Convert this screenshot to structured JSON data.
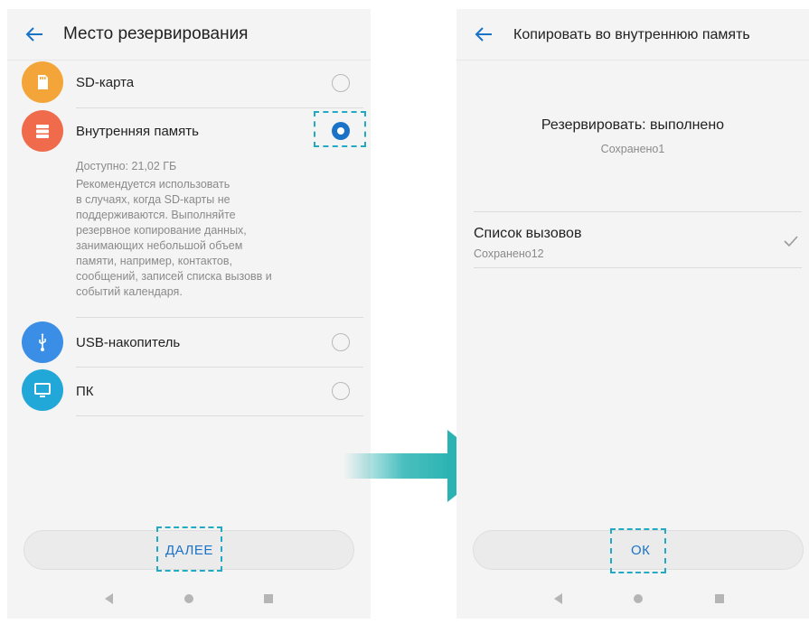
{
  "left": {
    "title": "Место резервирования",
    "options": [
      {
        "label": "SD-карта",
        "icon": "sd-card-icon",
        "color": "#f4a53a",
        "selected": false
      },
      {
        "label": "Внутренняя память",
        "icon": "storage-icon",
        "color": "#ef6b4b",
        "selected": true
      },
      {
        "label": "USB-накопитель",
        "icon": "usb-icon",
        "color": "#3a8ee6",
        "selected": false
      },
      {
        "label": "ПК",
        "icon": "monitor-icon",
        "color": "#21a8d8",
        "selected": false
      }
    ],
    "available": "Доступно: 21,02 ГБ",
    "description_lines": [
      "Рекомендуется использовать",
      "в случаях, когда SD-карты не",
      "поддерживаются. Выполняйте",
      "резервное копирование данных,",
      "занимающих небольшой объем",
      "памяти, например, контактов,",
      "сообщений, записей списка вызовв и",
      "событий календаря."
    ],
    "next_button": "ДАЛЕЕ"
  },
  "right": {
    "title": "Копировать во внутреннюю память",
    "status_title": "Резервировать: выполнено",
    "status_sub": "Сохранено1",
    "item_title": "Список вызовов",
    "item_sub": "Сохранено12",
    "ok_button": "ОК"
  },
  "colors": {
    "accent": "#1a73c7",
    "highlight_dash": "#22a9c4",
    "arrow": "#2bb3b3"
  }
}
